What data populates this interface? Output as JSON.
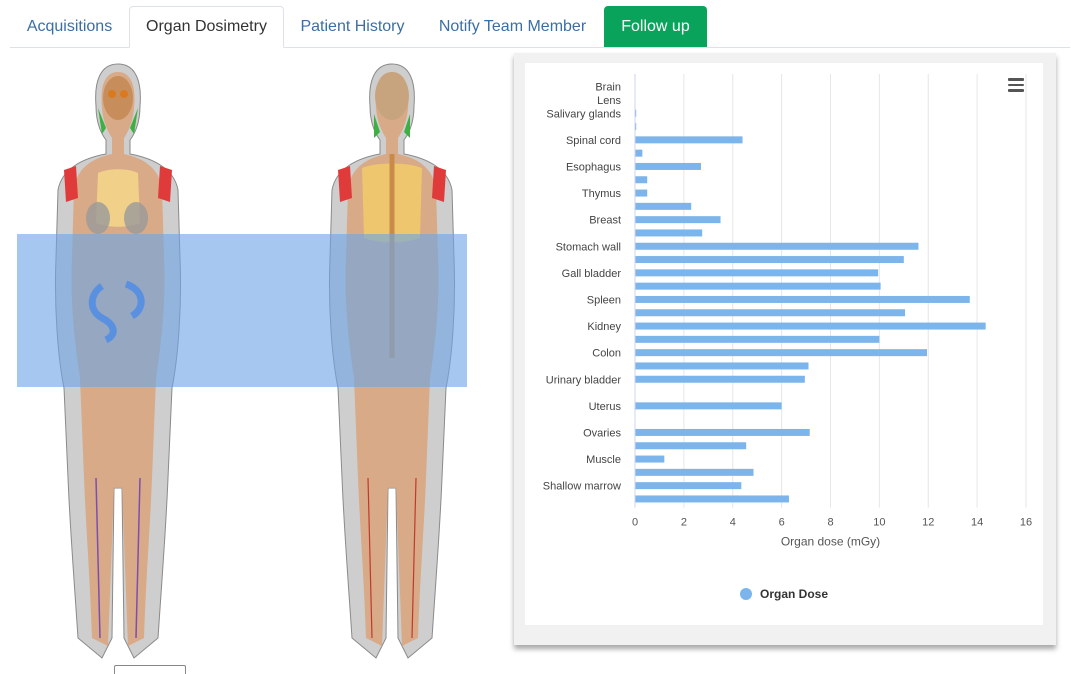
{
  "tabs": [
    {
      "label": "Acquisitions",
      "state": "inactive"
    },
    {
      "label": "Organ Dosimetry",
      "state": "active"
    },
    {
      "label": "Patient History",
      "state": "inactive"
    },
    {
      "label": "Notify Team Member",
      "state": "inactive"
    },
    {
      "label": "Follow up",
      "state": "highlight"
    }
  ],
  "colors": {
    "tab_link": "#3b6ea5",
    "follow_up_bg": "#0aa35c",
    "bar": "#7cb5ec",
    "scan_range": "#6ea5e6"
  },
  "icons": {
    "chart_menu": "hamburger-menu-icon"
  },
  "chart_data": {
    "type": "bar",
    "orientation": "horizontal",
    "category_labels": [
      "Brain",
      "Lens",
      "Salivary glands",
      "Spinal cord",
      "Esophagus",
      "Thymus",
      "Breast",
      "Stomach wall",
      "Gall bladder",
      "Spleen",
      "Kidney",
      "Colon",
      "Urinary bladder",
      "Uterus",
      "Ovaries",
      "Muscle",
      "Shallow marrow"
    ],
    "values": [
      0,
      0,
      0.05,
      0.05,
      4.4,
      0.3,
      2.7,
      0.5,
      0.5,
      2.3,
      3.5,
      2.75,
      11.6,
      11.0,
      9.95,
      10.05,
      13.7,
      11.05,
      14.35,
      10.0,
      11.95,
      7.1,
      6.95,
      0,
      6.0,
      0,
      7.15,
      4.55,
      1.2,
      4.85,
      4.35,
      6.3
    ],
    "label_rows": [
      0,
      1,
      2,
      4,
      6,
      8,
      10,
      12,
      14,
      16,
      18,
      20,
      22,
      24,
      26,
      28,
      30
    ],
    "xlabel": "Organ dose (mGy)",
    "x_ticks": [
      0,
      2,
      4,
      6,
      8,
      10,
      12,
      14,
      16
    ],
    "xlim": [
      0,
      16
    ],
    "grid": true,
    "legend": "bottom-center",
    "series": [
      {
        "name": "Organ Dose",
        "color": "#7cb5ec"
      }
    ]
  }
}
